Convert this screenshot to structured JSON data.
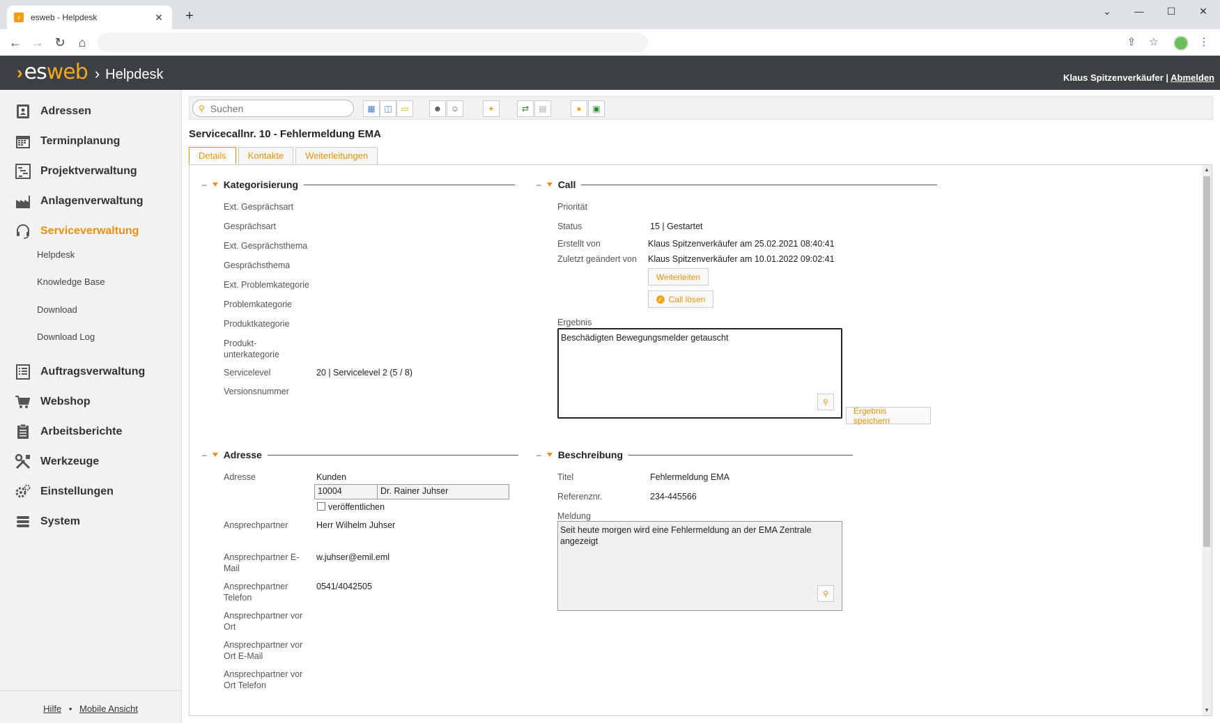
{
  "browser": {
    "tab_title": "esweb - Helpdesk",
    "tab_close": "✕",
    "new_tab": "+",
    "win_min": "⌄",
    "win_minimize": "—",
    "win_max": "☐",
    "win_close": "✕"
  },
  "header": {
    "logo_es": "es",
    "logo_web": "web",
    "logo_sep": "›",
    "app_name": "Helpdesk",
    "user_name": "Klaus Spitzenverkäufer",
    "separator": " | ",
    "logout": "Abmelden"
  },
  "sidebar": {
    "items": [
      {
        "label": "Adressen",
        "icon": "address-book-icon"
      },
      {
        "label": "Terminplanung",
        "icon": "calendar-icon"
      },
      {
        "label": "Projektverwaltung",
        "icon": "gantt-icon"
      },
      {
        "label": "Anlagenverwaltung",
        "icon": "factory-icon"
      },
      {
        "label": "Serviceverwaltung",
        "icon": "headset-icon"
      },
      {
        "label": "Auftragsverwaltung",
        "icon": "list-icon"
      },
      {
        "label": "Webshop",
        "icon": "cart-icon"
      },
      {
        "label": "Arbeitsberichte",
        "icon": "clipboard-icon"
      },
      {
        "label": "Werkzeuge",
        "icon": "tools-icon"
      },
      {
        "label": "Einstellungen",
        "icon": "gears-icon"
      },
      {
        "label": "System",
        "icon": "database-icon"
      }
    ],
    "sub_items": [
      "Helpdesk",
      "Knowledge Base",
      "Download",
      "Download Log"
    ],
    "footer_help": "Hilfe",
    "footer_bullet": "•",
    "footer_mobile": "Mobile Ansicht"
  },
  "toolbar": {
    "search_placeholder": "Suchen"
  },
  "page": {
    "title": "Servicecallnr. 10 - Fehlermeldung EMA",
    "tabs": [
      "Details",
      "Kontakte",
      "Weiterleitungen"
    ]
  },
  "kategorisierung": {
    "title": "Kategorisierung",
    "labels": {
      "ext_gespraechsart": "Ext. Gesprächsart",
      "gespraechsart": "Gesprächsart",
      "ext_gespraechsthema": "Ext. Gesprächsthema",
      "gespraechsthema": "Gesprächsthema",
      "ext_problemkategorie": "Ext. Problemkategorie",
      "problemkategorie": "Problemkategorie",
      "produktkategorie": "Produktkategorie",
      "produkt_1": "Produkt-",
      "produkt_2": "unterkategorie",
      "servicelevel": "Servicelevel",
      "versionsnummer": "Versionsnummer"
    },
    "servicelevel_value": "20 | Servicelevel 2 (5 / 8)"
  },
  "call": {
    "title": "Call",
    "prioritaet_label": "Priorität",
    "status_label": "Status",
    "status_value": "15 | Gestartet",
    "erstellt_label": "Erstellt von",
    "erstellt_value": "Klaus Spitzenverkäufer am 25.02.2021 08:40:41",
    "geaendert_label": "Zuletzt geändert von",
    "geaendert_value": "Klaus Spitzenverkäufer am 10.01.2022 09:02:41",
    "btn_weiterleiten": "Weiterleiten",
    "btn_loesen": "Call lösen",
    "ergebnis_label": "Ergebnis",
    "ergebnis_value": "Beschädigten Bewegungsmelder getauscht",
    "btn_ergebnis": "Ergebnis speichern"
  },
  "adresse": {
    "title": "Adresse",
    "adresse_label": "Adresse",
    "adresse_type": "Kunden",
    "adresse_nr": "10004",
    "adresse_name": "Dr.  Rainer Juhser",
    "veroeffentlichen": "veröffentlichen",
    "ap_label": "Ansprechpartner",
    "ap_value": "Herr Wilhelm Juhser",
    "ap_email_1": "Ansprechpartner E-",
    "ap_email_2": "Mail",
    "ap_email_value": "w.juhser@emil.eml",
    "ap_tel_1": "Ansprechpartner",
    "ap_tel_2": "Telefon",
    "ap_tel_value": "0541/4042505",
    "apo_1": "Ansprechpartner vor",
    "apo_2": "Ort",
    "apoe_1": "Ansprechpartner vor",
    "apoe_2": "Ort E-Mail",
    "apot_1": "Ansprechpartner vor",
    "apot_2": "Ort Telefon"
  },
  "beschreibung": {
    "title": "Beschreibung",
    "titel_label": "Titel",
    "titel_value": "Fehlermeldung EMA",
    "ref_label": "Referenznr.",
    "ref_value": "234-445566",
    "meldung_label": "Meldung",
    "meldung_value": "Seit heute morgen wird eine Fehlermeldung an der EMA Zentrale angezeigt"
  },
  "colors": {
    "accent": "#e8900c",
    "header_bg": "#3c4042",
    "sidebar_bg": "#f2f2f2"
  }
}
